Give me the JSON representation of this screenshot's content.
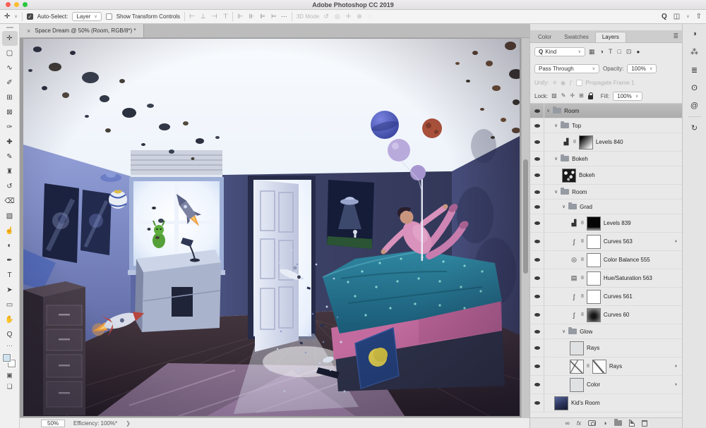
{
  "titlebar": {
    "title": "Adobe Photoshop CC 2019"
  },
  "colors": {
    "traffic_red": "#ff5f57",
    "traffic_yellow": "#febc2e",
    "traffic_green": "#29c73f",
    "accent_selection": "#b3b3b3"
  },
  "options_bar": {
    "tool_glyph": "✛",
    "chevron": "∨",
    "auto_select_label": "Auto-Select:",
    "auto_select_value": "Layer",
    "show_transform_label": "Show Transform Controls",
    "align_icons": [
      {
        "name": "align-left-icon",
        "glyph": "⊢"
      },
      {
        "name": "align-center-h-icon",
        "glyph": "⊥"
      },
      {
        "name": "align-right-icon",
        "glyph": "⊣"
      },
      {
        "name": "align-top-icon",
        "glyph": "⊤"
      }
    ],
    "distribute_icons": [
      {
        "name": "distribute-top-icon",
        "glyph": "⊩"
      },
      {
        "name": "distribute-center-icon",
        "glyph": "⊪"
      },
      {
        "name": "distribute-bottom-icon",
        "glyph": "⊫"
      },
      {
        "name": "distribute-left-icon",
        "glyph": "⊨"
      }
    ],
    "more_glyph": "⋯",
    "mode_3d_label": "3D Mode",
    "mode_3d_icons": [
      {
        "name": "3d-rotate-icon",
        "glyph": "↺"
      },
      {
        "name": "3d-roll-icon",
        "glyph": "◎"
      },
      {
        "name": "3d-drag-icon",
        "glyph": "✛"
      },
      {
        "name": "3d-slide-icon",
        "glyph": "⊕"
      },
      {
        "name": "3d-scale-icon",
        "glyph": "◌"
      }
    ],
    "search_glyph": "Q",
    "workspace_glyph": "◫",
    "share_glyph": "⇧"
  },
  "toolbar": {
    "tools": [
      {
        "name": "move-tool",
        "glyph": "✛",
        "selected": true
      },
      {
        "name": "marquee-tool",
        "glyph": "▢"
      },
      {
        "name": "lasso-tool",
        "glyph": "∿"
      },
      {
        "name": "quick-selection-tool",
        "glyph": "✐"
      },
      {
        "name": "crop-tool",
        "glyph": "⊞"
      },
      {
        "name": "frame-tool",
        "glyph": "⊠"
      },
      {
        "name": "eyedropper-tool",
        "glyph": "✑"
      },
      {
        "name": "healing-brush-tool",
        "glyph": "✚"
      },
      {
        "name": "brush-tool",
        "glyph": "✎"
      },
      {
        "name": "clone-stamp-tool",
        "glyph": "♜"
      },
      {
        "name": "history-brush-tool",
        "glyph": "↺"
      },
      {
        "name": "eraser-tool",
        "glyph": "⌫"
      },
      {
        "name": "gradient-tool",
        "glyph": "▧"
      },
      {
        "name": "smudge-tool",
        "glyph": "☝"
      },
      {
        "name": "dodge-tool",
        "glyph": "◐"
      },
      {
        "name": "pen-tool",
        "glyph": "✒"
      },
      {
        "name": "type-tool",
        "glyph": "T"
      },
      {
        "name": "path-selection-tool",
        "glyph": "➤"
      },
      {
        "name": "shape-tool",
        "glyph": "▭"
      },
      {
        "name": "hand-tool",
        "glyph": "✋"
      },
      {
        "name": "zoom-tool",
        "glyph": "Q"
      }
    ],
    "more_glyph": "⋯",
    "foreground_color": "#cfe4f0",
    "background_color": "#ffffff",
    "quick_mask_glyph": "▣",
    "screen_mode_glyph": "❏"
  },
  "document": {
    "close_glyph": "×",
    "tab_title": "Space Dream @ 50% (Room, RGB/8*) *",
    "zoom_level": "50%",
    "efficiency": "Efficiency: 100%*",
    "status_chevron": "❯"
  },
  "panels": {
    "tabs": [
      {
        "label": "Color",
        "active": false
      },
      {
        "label": "Swatches",
        "active": false
      },
      {
        "label": "Layers",
        "active": true
      }
    ],
    "menu_glyph": "≣",
    "filter": {
      "search_glyph": "Q",
      "kind_value": "Kind",
      "chevron": "∨",
      "icons": [
        {
          "name": "filter-pixel-icon",
          "glyph": "▦"
        },
        {
          "name": "filter-adjustment-icon",
          "glyph": "◑"
        },
        {
          "name": "filter-type-icon",
          "glyph": "T"
        },
        {
          "name": "filter-shape-icon",
          "glyph": "□"
        },
        {
          "name": "filter-smart-object-icon",
          "glyph": "⊡"
        }
      ],
      "toggle_glyph": "●"
    },
    "blend_mode_value": "Pass Through",
    "opacity_label": "Opacity:",
    "opacity_value": "100%",
    "unify_label": "Unify:",
    "unify_icons": [
      {
        "name": "unify-position-icon",
        "glyph": "✛"
      },
      {
        "name": "unify-visibility-icon",
        "glyph": "◉"
      },
      {
        "name": "unify-style-icon",
        "glyph": "ƒ"
      }
    ],
    "propagate_label": "Propagate Frame 1",
    "lock_label": "Lock:",
    "lock_icons": [
      {
        "name": "lock-transparency-icon",
        "glyph": "▨"
      },
      {
        "name": "lock-paint-icon",
        "glyph": "✎"
      },
      {
        "name": "lock-position-icon",
        "glyph": "✛"
      },
      {
        "name": "lock-artboard-icon",
        "glyph": "⊞"
      },
      {
        "name": "lock-all-icon",
        "glyph": "css-lock"
      }
    ],
    "fill_label": "Fill:",
    "fill_value": "100%",
    "adj_icons": {
      "levels": "▟",
      "curves": "ʃ",
      "balance": "◎",
      "huesat": "▤"
    },
    "group_chevron": "∨",
    "link_glyph": "8",
    "badge_glyph": "◑",
    "layers": [
      {
        "kind": "group",
        "name": "Room",
        "indent": 0,
        "selected": true
      },
      {
        "kind": "group",
        "name": "Top",
        "indent": 1
      },
      {
        "kind": "adj",
        "name": "Levels 840",
        "indent": 2,
        "icon": "levels",
        "mask": "gradient"
      },
      {
        "kind": "group",
        "name": "Bokeh",
        "indent": 1
      },
      {
        "kind": "pixel",
        "name": "Bokeh",
        "indent": 2,
        "thumb": "bokeh"
      },
      {
        "kind": "group",
        "name": "Room",
        "indent": 1
      },
      {
        "kind": "group",
        "name": "Grad",
        "indent": 2
      },
      {
        "kind": "adj",
        "name": "Levels 839",
        "indent": 3,
        "icon": "levels",
        "mask": "black"
      },
      {
        "kind": "adj",
        "name": "Curves 563",
        "indent": 3,
        "icon": "curves",
        "mask": "white",
        "badge": true
      },
      {
        "kind": "adj",
        "name": "Color Balance 555",
        "indent": 3,
        "icon": "balance",
        "mask": "white"
      },
      {
        "kind": "adj",
        "name": "Hue/Saturation 563",
        "indent": 3,
        "icon": "huesat",
        "mask": "white"
      },
      {
        "kind": "adj",
        "name": "Curves 561",
        "indent": 3,
        "icon": "curves",
        "mask": "white"
      },
      {
        "kind": "adj",
        "name": "Curves 60",
        "indent": 3,
        "icon": "curves",
        "mask": "radial"
      },
      {
        "kind": "group",
        "name": "Glow",
        "indent": 2
      },
      {
        "kind": "pixel",
        "name": "Rays",
        "indent": 3,
        "thumb": "gray"
      },
      {
        "kind": "pixelmask",
        "name": "Rays",
        "indent": 3,
        "thumb": "rays",
        "mask": "raysmask",
        "badge": true
      },
      {
        "kind": "pixel",
        "name": "Color",
        "indent": 3,
        "thumb": "gray",
        "badge": true
      },
      {
        "kind": "pixel",
        "name": "Kid's Room",
        "indent": 1,
        "thumb": "room"
      }
    ],
    "bottom_icons": [
      {
        "name": "link-layers-icon",
        "glyph": "∞"
      },
      {
        "name": "layer-effects-icon",
        "glyph": "fx"
      },
      {
        "name": "add-mask-icon",
        "glyph": "css-mask"
      },
      {
        "name": "new-adjustment-icon",
        "glyph": "◑"
      },
      {
        "name": "new-group-icon",
        "glyph": "css-folder"
      },
      {
        "name": "new-layer-icon",
        "glyph": "css-newlayer"
      },
      {
        "name": "delete-layer-icon",
        "glyph": "css-trash"
      }
    ]
  },
  "right_rail": {
    "icons": [
      {
        "name": "adjustments-icon",
        "glyph": "◑"
      },
      {
        "name": "glyphs-icon",
        "glyph": "⁂"
      },
      {
        "name": "character-icon",
        "glyph": "≣"
      },
      {
        "name": "learn-icon",
        "glyph": "ʘ"
      },
      {
        "name": "libraries-icon",
        "glyph": "@"
      },
      {
        "name": "history-icon",
        "glyph": "↻"
      }
    ]
  }
}
